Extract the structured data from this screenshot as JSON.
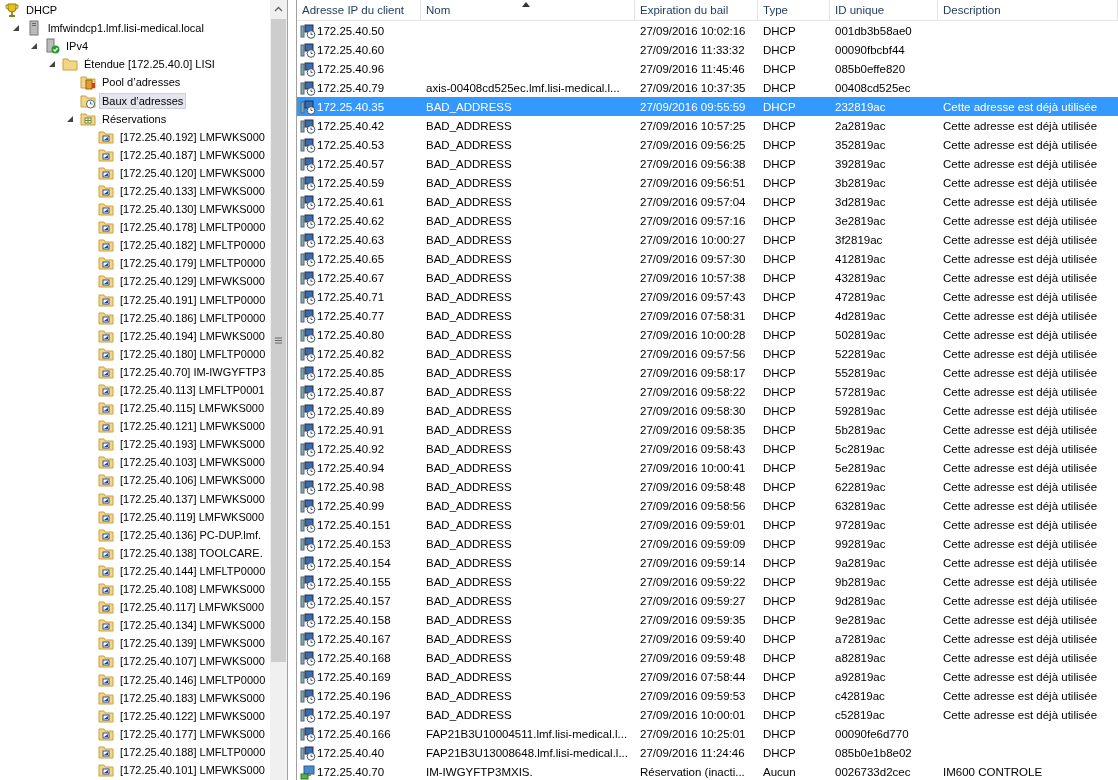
{
  "tree": {
    "nodes": [
      {
        "label": "DHCP",
        "kind": "dhcp",
        "selected": false,
        "children": [
          {
            "label": "lmfwindcp1.lmf.lisi-medical.local",
            "kind": "server",
            "expanded": true,
            "selected": false,
            "children": [
              {
                "label": "IPv4",
                "kind": "ipv4",
                "expanded": true,
                "selected": false,
                "children": [
                  {
                    "label": "Étendue [172.25.40.0] LISI",
                    "kind": "scope",
                    "expanded": true,
                    "selected": false,
                    "children": [
                      {
                        "label": "Pool d’adresses",
                        "kind": "pool",
                        "selected": false
                      },
                      {
                        "label": "Baux d’adresses",
                        "kind": "leases",
                        "selected": true
                      },
                      {
                        "label": "Réservations",
                        "kind": "reservations",
                        "expanded": true,
                        "selected": false,
                        "children": [
                          {
                            "label": "[172.25.40.192] LMFWKS000",
                            "kind": "reservation",
                            "selected": false
                          },
                          {
                            "label": "[172.25.40.187] LMFWKS000",
                            "kind": "reservation",
                            "selected": false
                          },
                          {
                            "label": "[172.25.40.120] LMFWKS000",
                            "kind": "reservation",
                            "selected": false
                          },
                          {
                            "label": "[172.25.40.133] LMFWKS000",
                            "kind": "reservation",
                            "selected": false
                          },
                          {
                            "label": "[172.25.40.130] LMFWKS000",
                            "kind": "reservation",
                            "selected": false
                          },
                          {
                            "label": "[172.25.40.178] LMFLTP0000",
                            "kind": "reservation",
                            "selected": false
                          },
                          {
                            "label": "[172.25.40.182] LMFLTP0000",
                            "kind": "reservation",
                            "selected": false
                          },
                          {
                            "label": "[172.25.40.179] LMFLTP0000",
                            "kind": "reservation",
                            "selected": false
                          },
                          {
                            "label": "[172.25.40.129] LMFWKS000",
                            "kind": "reservation",
                            "selected": false
                          },
                          {
                            "label": "[172.25.40.191] LMFLTP0000",
                            "kind": "reservation",
                            "selected": false
                          },
                          {
                            "label": "[172.25.40.186] LMFLTP0000",
                            "kind": "reservation",
                            "selected": false
                          },
                          {
                            "label": "[172.25.40.194] LMFWKS000",
                            "kind": "reservation",
                            "selected": false
                          },
                          {
                            "label": "[172.25.40.180] LMFLTP0000",
                            "kind": "reservation",
                            "selected": false
                          },
                          {
                            "label": "[172.25.40.70] IM-IWGYFTP3",
                            "kind": "reservation",
                            "selected": false
                          },
                          {
                            "label": "[172.25.40.113] LMFLTP0001",
                            "kind": "reservation",
                            "selected": false
                          },
                          {
                            "label": "[172.25.40.115] LMFWKS000",
                            "kind": "reservation",
                            "selected": false
                          },
                          {
                            "label": "[172.25.40.121] LMFWKS000",
                            "kind": "reservation",
                            "selected": false
                          },
                          {
                            "label": "[172.25.40.193] LMFWKS000",
                            "kind": "reservation",
                            "selected": false
                          },
                          {
                            "label": "[172.25.40.103] LMFWKS000",
                            "kind": "reservation",
                            "selected": false
                          },
                          {
                            "label": "[172.25.40.106] LMFWKS000",
                            "kind": "reservation",
                            "selected": false
                          },
                          {
                            "label": "[172.25.40.137] LMFWKS000",
                            "kind": "reservation",
                            "selected": false
                          },
                          {
                            "label": "[172.25.40.119] LMFWKS000",
                            "kind": "reservation",
                            "selected": false
                          },
                          {
                            "label": "[172.25.40.136] PC-DUP.lmf.",
                            "kind": "reservation",
                            "selected": false
                          },
                          {
                            "label": "[172.25.40.138] TOOLCARE.",
                            "kind": "reservation",
                            "selected": false
                          },
                          {
                            "label": "[172.25.40.144] LMFLTP0000",
                            "kind": "reservation",
                            "selected": false
                          },
                          {
                            "label": "[172.25.40.108] LMFWKS000",
                            "kind": "reservation",
                            "selected": false
                          },
                          {
                            "label": "[172.25.40.117] LMFWKS000",
                            "kind": "reservation",
                            "selected": false
                          },
                          {
                            "label": "[172.25.40.134] LMFWKS000",
                            "kind": "reservation",
                            "selected": false
                          },
                          {
                            "label": "[172.25.40.139] LMFWKS000",
                            "kind": "reservation",
                            "selected": false
                          },
                          {
                            "label": "[172.25.40.107] LMFWKS000",
                            "kind": "reservation",
                            "selected": false
                          },
                          {
                            "label": "[172.25.40.146] LMFLTP0000",
                            "kind": "reservation",
                            "selected": false
                          },
                          {
                            "label": "[172.25.40.183] LMFWKS000",
                            "kind": "reservation",
                            "selected": false
                          },
                          {
                            "label": "[172.25.40.122] LMFWKS000",
                            "kind": "reservation",
                            "selected": false
                          },
                          {
                            "label": "[172.25.40.177] LMFWKS000",
                            "kind": "reservation",
                            "selected": false
                          },
                          {
                            "label": "[172.25.40.188] LMFLTP0000",
                            "kind": "reservation",
                            "selected": false
                          },
                          {
                            "label": "[172.25.40.101] LMFWKS000",
                            "kind": "reservation",
                            "selected": false
                          }
                        ]
                      }
                    ]
                  }
                ]
              }
            ]
          }
        ]
      }
    ]
  },
  "table": {
    "columns": [
      {
        "label": "Adresse IP du client",
        "sorted": false
      },
      {
        "label": "Nom",
        "sorted": true
      },
      {
        "label": "Expiration du bail",
        "sorted": false
      },
      {
        "label": "Type",
        "sorted": false
      },
      {
        "label": "ID unique",
        "sorted": false
      },
      {
        "label": "Description",
        "sorted": false
      }
    ],
    "rows": [
      {
        "kind": "lease",
        "ip": "172.25.40.50",
        "expiration": "27/09/2016 10:02:16",
        "type": "DHCP",
        "unique_id": "001db3b58ae0",
        "selected": false
      },
      {
        "kind": "lease",
        "ip": "172.25.40.60",
        "expiration": "27/09/2016 11:33:32",
        "type": "DHCP",
        "unique_id": "00090fbcbf44",
        "selected": false
      },
      {
        "kind": "lease",
        "ip": "172.25.40.96",
        "expiration": "27/09/2016 11:45:46",
        "type": "DHCP",
        "unique_id": "085b0effe820",
        "selected": false
      },
      {
        "kind": "lease",
        "ip": "172.25.40.79",
        "name": "axis-00408cd525ec.lmf.lisi-medical.l...",
        "expiration": "27/09/2016 10:37:35",
        "type": "DHCP",
        "unique_id": "00408cd525ec",
        "selected": false
      },
      {
        "kind": "lease",
        "ip": "172.25.40.35",
        "name": "BAD_ADDRESS",
        "expiration": "27/09/2016 09:55:59",
        "type": "DHCP",
        "unique_id": "232819ac",
        "description": "Cette adresse est déjà utilisée",
        "selected": true
      },
      {
        "kind": "lease",
        "ip": "172.25.40.42",
        "name": "BAD_ADDRESS",
        "expiration": "27/09/2016 10:57:25",
        "type": "DHCP",
        "unique_id": "2a2819ac",
        "description": "Cette adresse est déjà utilisée",
        "selected": false
      },
      {
        "kind": "lease",
        "ip": "172.25.40.53",
        "name": "BAD_ADDRESS",
        "expiration": "27/09/2016 09:56:25",
        "type": "DHCP",
        "unique_id": "352819ac",
        "description": "Cette adresse est déjà utilisée",
        "selected": false
      },
      {
        "kind": "lease",
        "ip": "172.25.40.57",
        "name": "BAD_ADDRESS",
        "expiration": "27/09/2016 09:56:38",
        "type": "DHCP",
        "unique_id": "392819ac",
        "description": "Cette adresse est déjà utilisée",
        "selected": false
      },
      {
        "kind": "lease",
        "ip": "172.25.40.59",
        "name": "BAD_ADDRESS",
        "expiration": "27/09/2016 09:56:51",
        "type": "DHCP",
        "unique_id": "3b2819ac",
        "description": "Cette adresse est déjà utilisée",
        "selected": false
      },
      {
        "kind": "lease",
        "ip": "172.25.40.61",
        "name": "BAD_ADDRESS",
        "expiration": "27/09/2016 09:57:04",
        "type": "DHCP",
        "unique_id": "3d2819ac",
        "description": "Cette adresse est déjà utilisée",
        "selected": false
      },
      {
        "kind": "lease",
        "ip": "172.25.40.62",
        "name": "BAD_ADDRESS",
        "expiration": "27/09/2016 09:57:16",
        "type": "DHCP",
        "unique_id": "3e2819ac",
        "description": "Cette adresse est déjà utilisée",
        "selected": false
      },
      {
        "kind": "lease",
        "ip": "172.25.40.63",
        "name": "BAD_ADDRESS",
        "expiration": "27/09/2016 10:00:27",
        "type": "DHCP",
        "unique_id": "3f2819ac",
        "description": "Cette adresse est déjà utilisée",
        "selected": false
      },
      {
        "kind": "lease",
        "ip": "172.25.40.65",
        "name": "BAD_ADDRESS",
        "expiration": "27/09/2016 09:57:30",
        "type": "DHCP",
        "unique_id": "412819ac",
        "description": "Cette adresse est déjà utilisée",
        "selected": false
      },
      {
        "kind": "lease",
        "ip": "172.25.40.67",
        "name": "BAD_ADDRESS",
        "expiration": "27/09/2016 10:57:38",
        "type": "DHCP",
        "unique_id": "432819ac",
        "description": "Cette adresse est déjà utilisée",
        "selected": false
      },
      {
        "kind": "lease",
        "ip": "172.25.40.71",
        "name": "BAD_ADDRESS",
        "expiration": "27/09/2016 09:57:43",
        "type": "DHCP",
        "unique_id": "472819ac",
        "description": "Cette adresse est déjà utilisée",
        "selected": false
      },
      {
        "kind": "lease",
        "ip": "172.25.40.77",
        "name": "BAD_ADDRESS",
        "expiration": "27/09/2016 07:58:31",
        "type": "DHCP",
        "unique_id": "4d2819ac",
        "description": "Cette adresse est déjà utilisée",
        "selected": false
      },
      {
        "kind": "lease",
        "ip": "172.25.40.80",
        "name": "BAD_ADDRESS",
        "expiration": "27/09/2016 10:00:28",
        "type": "DHCP",
        "unique_id": "502819ac",
        "description": "Cette adresse est déjà utilisée",
        "selected": false
      },
      {
        "kind": "lease",
        "ip": "172.25.40.82",
        "name": "BAD_ADDRESS",
        "expiration": "27/09/2016 09:57:56",
        "type": "DHCP",
        "unique_id": "522819ac",
        "description": "Cette adresse est déjà utilisée",
        "selected": false
      },
      {
        "kind": "lease",
        "ip": "172.25.40.85",
        "name": "BAD_ADDRESS",
        "expiration": "27/09/2016 09:58:17",
        "type": "DHCP",
        "unique_id": "552819ac",
        "description": "Cette adresse est déjà utilisée",
        "selected": false
      },
      {
        "kind": "lease",
        "ip": "172.25.40.87",
        "name": "BAD_ADDRESS",
        "expiration": "27/09/2016 09:58:22",
        "type": "DHCP",
        "unique_id": "572819ac",
        "description": "Cette adresse est déjà utilisée",
        "selected": false
      },
      {
        "kind": "lease",
        "ip": "172.25.40.89",
        "name": "BAD_ADDRESS",
        "expiration": "27/09/2016 09:58:30",
        "type": "DHCP",
        "unique_id": "592819ac",
        "description": "Cette adresse est déjà utilisée",
        "selected": false
      },
      {
        "kind": "lease",
        "ip": "172.25.40.91",
        "name": "BAD_ADDRESS",
        "expiration": "27/09/2016 09:58:35",
        "type": "DHCP",
        "unique_id": "5b2819ac",
        "description": "Cette adresse est déjà utilisée",
        "selected": false
      },
      {
        "kind": "lease",
        "ip": "172.25.40.92",
        "name": "BAD_ADDRESS",
        "expiration": "27/09/2016 09:58:43",
        "type": "DHCP",
        "unique_id": "5c2819ac",
        "description": "Cette adresse est déjà utilisée",
        "selected": false
      },
      {
        "kind": "lease",
        "ip": "172.25.40.94",
        "name": "BAD_ADDRESS",
        "expiration": "27/09/2016 10:00:41",
        "type": "DHCP",
        "unique_id": "5e2819ac",
        "description": "Cette adresse est déjà utilisée",
        "selected": false
      },
      {
        "kind": "lease",
        "ip": "172.25.40.98",
        "name": "BAD_ADDRESS",
        "expiration": "27/09/2016 09:58:48",
        "type": "DHCP",
        "unique_id": "622819ac",
        "description": "Cette adresse est déjà utilisée",
        "selected": false
      },
      {
        "kind": "lease",
        "ip": "172.25.40.99",
        "name": "BAD_ADDRESS",
        "expiration": "27/09/2016 09:58:56",
        "type": "DHCP",
        "unique_id": "632819ac",
        "description": "Cette adresse est déjà utilisée",
        "selected": false
      },
      {
        "kind": "lease",
        "ip": "172.25.40.151",
        "name": "BAD_ADDRESS",
        "expiration": "27/09/2016 09:59:01",
        "type": "DHCP",
        "unique_id": "972819ac",
        "description": "Cette adresse est déjà utilisée",
        "selected": false
      },
      {
        "kind": "lease",
        "ip": "172.25.40.153",
        "name": "BAD_ADDRESS",
        "expiration": "27/09/2016 09:59:09",
        "type": "DHCP",
        "unique_id": "992819ac",
        "description": "Cette adresse est déjà utilisée",
        "selected": false
      },
      {
        "kind": "lease",
        "ip": "172.25.40.154",
        "name": "BAD_ADDRESS",
        "expiration": "27/09/2016 09:59:14",
        "type": "DHCP",
        "unique_id": "9a2819ac",
        "description": "Cette adresse est déjà utilisée",
        "selected": false
      },
      {
        "kind": "lease",
        "ip": "172.25.40.155",
        "name": "BAD_ADDRESS",
        "expiration": "27/09/2016 09:59:22",
        "type": "DHCP",
        "unique_id": "9b2819ac",
        "description": "Cette adresse est déjà utilisée",
        "selected": false
      },
      {
        "kind": "lease",
        "ip": "172.25.40.157",
        "name": "BAD_ADDRESS",
        "expiration": "27/09/2016 09:59:27",
        "type": "DHCP",
        "unique_id": "9d2819ac",
        "description": "Cette adresse est déjà utilisée",
        "selected": false
      },
      {
        "kind": "lease",
        "ip": "172.25.40.158",
        "name": "BAD_ADDRESS",
        "expiration": "27/09/2016 09:59:35",
        "type": "DHCP",
        "unique_id": "9e2819ac",
        "description": "Cette adresse est déjà utilisée",
        "selected": false
      },
      {
        "kind": "lease",
        "ip": "172.25.40.167",
        "name": "BAD_ADDRESS",
        "expiration": "27/09/2016 09:59:40",
        "type": "DHCP",
        "unique_id": "a72819ac",
        "description": "Cette adresse est déjà utilisée",
        "selected": false
      },
      {
        "kind": "lease",
        "ip": "172.25.40.168",
        "name": "BAD_ADDRESS",
        "expiration": "27/09/2016 09:59:48",
        "type": "DHCP",
        "unique_id": "a82819ac",
        "description": "Cette adresse est déjà utilisée",
        "selected": false
      },
      {
        "kind": "lease",
        "ip": "172.25.40.169",
        "name": "BAD_ADDRESS",
        "expiration": "27/09/2016 07:58:44",
        "type": "DHCP",
        "unique_id": "a92819ac",
        "description": "Cette adresse est déjà utilisée",
        "selected": false
      },
      {
        "kind": "lease",
        "ip": "172.25.40.196",
        "name": "BAD_ADDRESS",
        "expiration": "27/09/2016 09:59:53",
        "type": "DHCP",
        "unique_id": "c42819ac",
        "description": "Cette adresse est déjà utilisée",
        "selected": false
      },
      {
        "kind": "lease",
        "ip": "172.25.40.197",
        "name": "BAD_ADDRESS",
        "expiration": "27/09/2016 10:00:01",
        "type": "DHCP",
        "unique_id": "c52819ac",
        "description": "Cette adresse est déjà utilisée",
        "selected": false
      },
      {
        "kind": "lease",
        "ip": "172.25.40.166",
        "name": "FAP21B3U10004511.lmf.lisi-medical.l...",
        "expiration": "27/09/2016 10:25:01",
        "type": "DHCP",
        "unique_id": "00090fe6d770",
        "selected": false
      },
      {
        "kind": "lease",
        "ip": "172.25.40.40",
        "name": "FAP21B3U13008648.lmf.lisi-medical.l...",
        "expiration": "27/09/2016 11:24:46",
        "type": "DHCP",
        "unique_id": "085b0e1b8e02",
        "selected": false
      },
      {
        "kind": "reservation",
        "ip": "172.25.40.70",
        "name": "IM-IWGYFTP3MXIS.",
        "expiration": "Réservation (inacti...",
        "type": "Aucun",
        "unique_id": "0026733d2cec",
        "description": "IM600 CONTROLE",
        "selected": false
      }
    ]
  }
}
